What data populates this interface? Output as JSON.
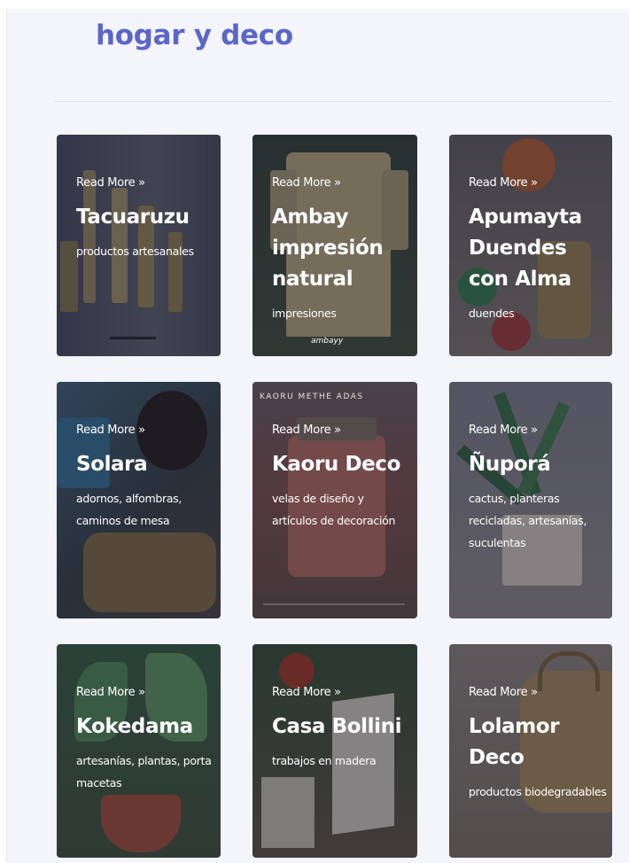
{
  "page": {
    "title": "hogar y deco"
  },
  "cards": [
    {
      "read_more": "Read More »",
      "title": "Tacuaruzu",
      "description": "productos artesanales"
    },
    {
      "read_more": "Read More »",
      "title": "Ambay impresión natural",
      "description": "impresiones",
      "photo_caption": "ambayy"
    },
    {
      "read_more": "Read More »",
      "title": "Apumayta Duendes con Alma",
      "description": "duendes"
    },
    {
      "read_more": "Read More »",
      "title": "Solara",
      "description": "adornos, alfombras, caminos de mesa"
    },
    {
      "read_more": "Read More »",
      "title": "Kaoru Deco",
      "description": "velas de diseño y artículos de decoración",
      "photo_caption": "KAORU METHE ADAS"
    },
    {
      "read_more": "Read More »",
      "title": "Ñuporá",
      "description": "cactus, planteras recicladas, artesanías, suculentas"
    },
    {
      "read_more": "Read More »",
      "title": "Kokedama",
      "description": "artesanías, plantas, porta macetas"
    },
    {
      "read_more": "Read More »",
      "title": "Casa Bollini",
      "description": "trabajos en madera"
    },
    {
      "read_more": "Read More »",
      "title": "Lolamor Deco",
      "description": "productos biodegradables"
    }
  ]
}
